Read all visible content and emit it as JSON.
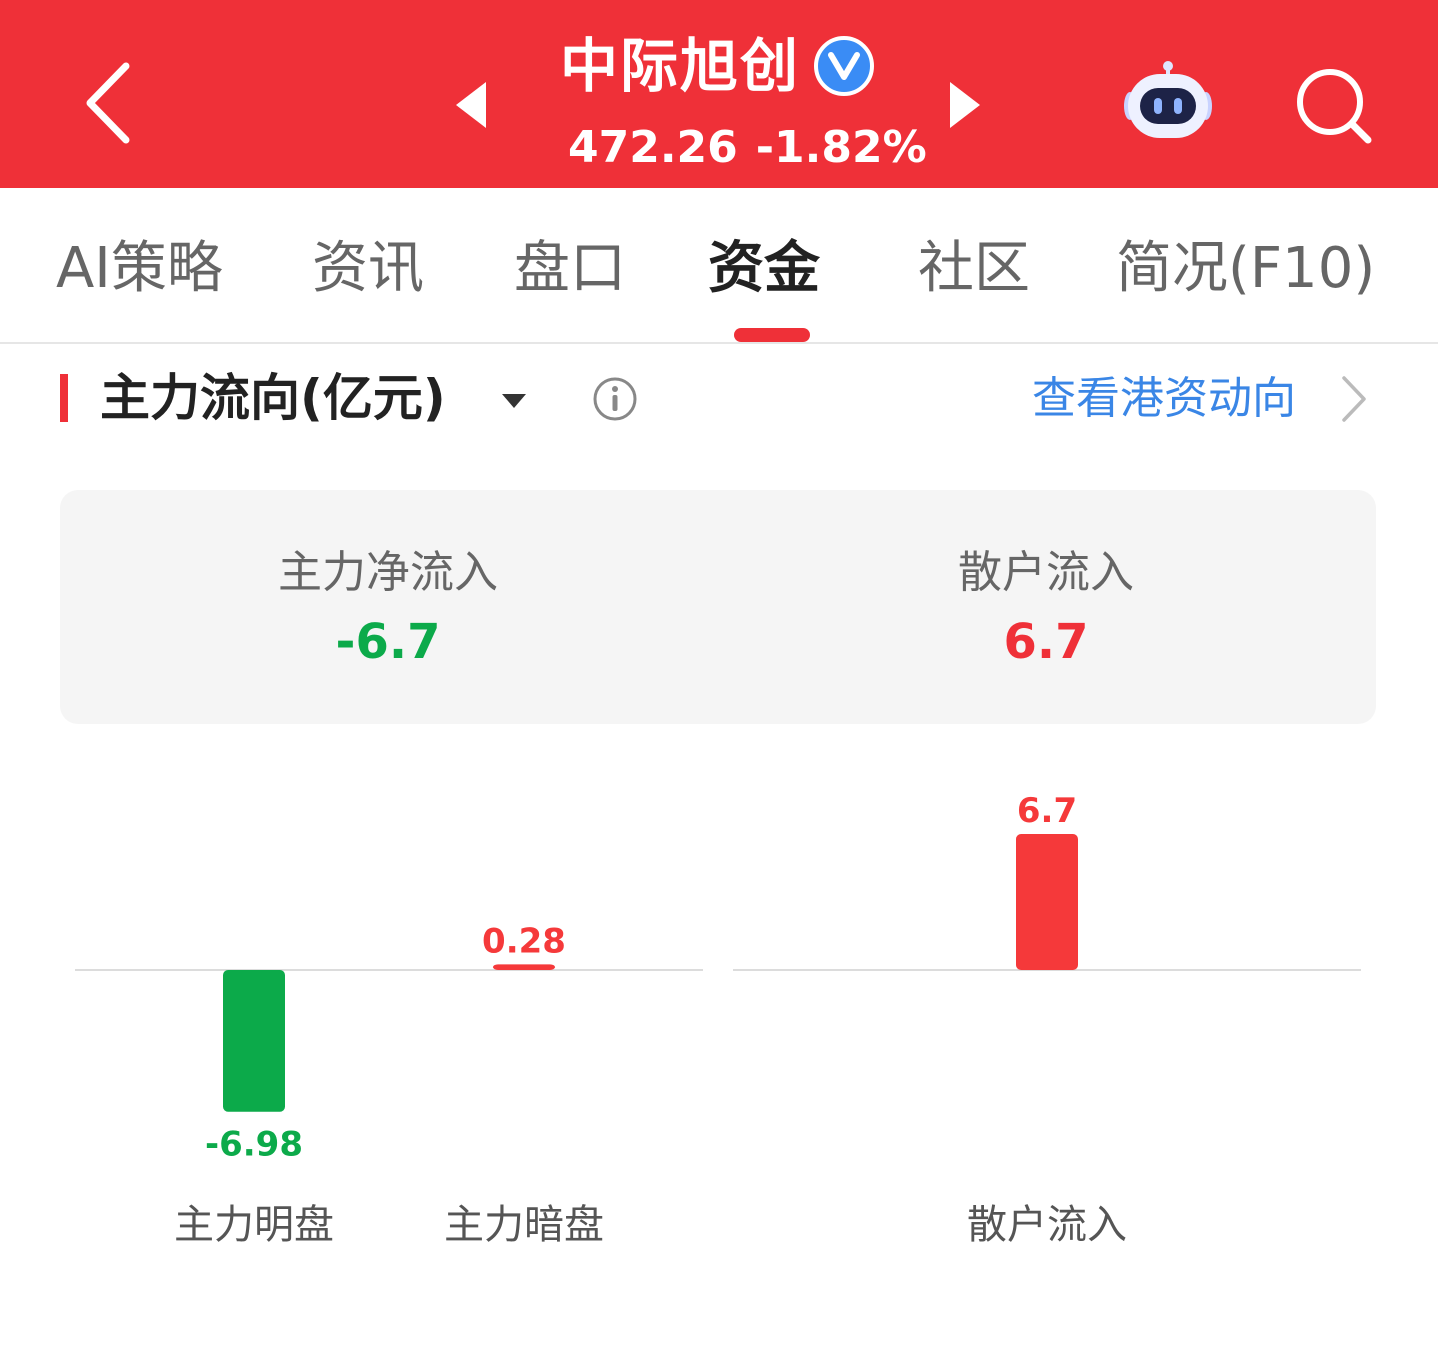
{
  "header": {
    "stock_name": "中际旭创",
    "price": "472.26",
    "change_pct": "-1.82%",
    "bg_color": "#ef3038",
    "icons": [
      "back-icon",
      "prev-stock-icon",
      "verified-icon",
      "next-stock-icon",
      "robot-assistant-icon",
      "search-icon"
    ]
  },
  "tabs": [
    {
      "label": "AI策略",
      "active": false
    },
    {
      "label": "资讯",
      "active": false
    },
    {
      "label": "盘口",
      "active": false
    },
    {
      "label": "资金",
      "active": true
    },
    {
      "label": "社区",
      "active": false
    },
    {
      "label": "简况(F10)",
      "active": false
    }
  ],
  "section": {
    "title": "主力流向(亿元)",
    "hk_link": "查看港资动向"
  },
  "summary": {
    "main_net_inflow_label": "主力净流入",
    "main_net_inflow_value": "-6.7",
    "retail_inflow_label": "散户流入",
    "retail_inflow_value": "6.7"
  },
  "chart_data": {
    "type": "bar",
    "categories": [
      "主力明盘",
      "主力暗盘",
      "散户流入"
    ],
    "values": [
      -6.98,
      0.28,
      6.7
    ],
    "value_labels": [
      "-6.98",
      "0.28",
      "6.7"
    ],
    "positive_color": "#f5393a",
    "negative_color": "#0caa4a"
  }
}
